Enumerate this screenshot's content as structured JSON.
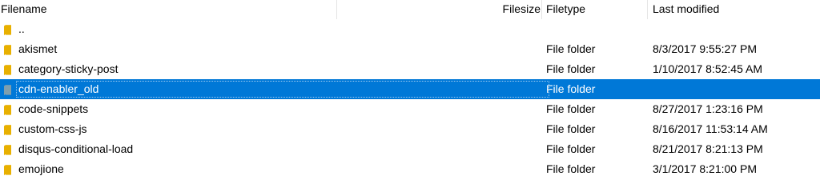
{
  "columns": {
    "filename": "Filename",
    "filesize": "Filesize",
    "filetype": "Filetype",
    "last_modified": "Last modified"
  },
  "colors": {
    "selection": "#0078d7",
    "folder": "#e8b000",
    "folder_selected": "#7e9fae"
  },
  "rows": [
    {
      "name": "..",
      "type": "",
      "modified": "",
      "icon": "folder-icon",
      "selected": false
    },
    {
      "name": "akismet",
      "type": "File folder",
      "modified": "8/3/2017 9:55:27 PM",
      "icon": "folder-icon",
      "selected": false
    },
    {
      "name": "category-sticky-post",
      "type": "File folder",
      "modified": "1/10/2017 8:52:45 AM",
      "icon": "folder-icon",
      "selected": false
    },
    {
      "name": "cdn-enabler_old",
      "type": "File folder",
      "modified": "",
      "icon": "folder-icon",
      "selected": true
    },
    {
      "name": "code-snippets",
      "type": "File folder",
      "modified": "8/27/2017 1:23:16 PM",
      "icon": "folder-icon",
      "selected": false
    },
    {
      "name": "custom-css-js",
      "type": "File folder",
      "modified": "8/16/2017 11:53:14 AM",
      "icon": "folder-icon",
      "selected": false
    },
    {
      "name": "disqus-conditional-load",
      "type": "File folder",
      "modified": "8/21/2017 8:21:13 PM",
      "icon": "folder-icon",
      "selected": false
    },
    {
      "name": "emojione",
      "type": "File folder",
      "modified": "3/1/2017 8:21:00 PM",
      "icon": "folder-icon",
      "selected": false
    }
  ]
}
